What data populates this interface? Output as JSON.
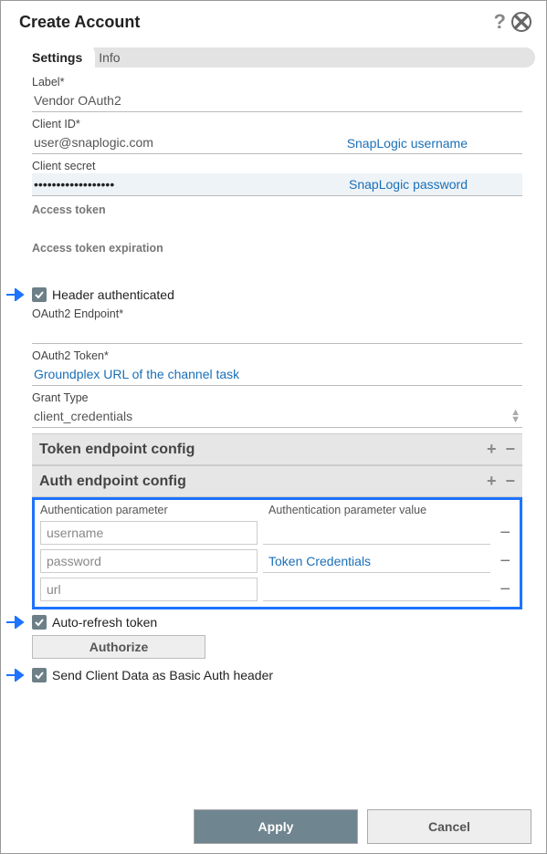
{
  "title": "Create Account",
  "tabs": {
    "active": "Settings",
    "inactive": "Info"
  },
  "fields": {
    "labelLabel": "Label*",
    "labelValue": "Vendor OAuth2",
    "clientIdLabel": "Client ID*",
    "clientIdValue": "user@snaplogic.com",
    "clientIdHint": "SnapLogic username",
    "clientSecretLabel": "Client secret",
    "clientSecretValue": "••••••••••••••••••",
    "clientSecretHint": "SnapLogic password",
    "accessTokenLabel": "Access token",
    "accessTokenExpLabel": "Access token expiration",
    "headerAuthLabel": "Header authenticated",
    "oauthEndpointLabel": "OAuth2 Endpoint*",
    "oauthTokenLabel": "OAuth2 Token*",
    "oauthTokenValue": "Groundplex URL of the channel task",
    "grantTypeLabel": "Grant Type",
    "grantTypeValue": "client_credentials",
    "tokenEndpointHeader": "Token endpoint config",
    "authEndpointHeader": "Auth endpoint config",
    "authParamHeader": "Authentication parameter",
    "authValueHeader": "Authentication parameter value",
    "authRows": [
      {
        "param": "username",
        "value": ""
      },
      {
        "param": "password",
        "value": "Token Credentials"
      },
      {
        "param": "url",
        "value": ""
      }
    ],
    "autoRefreshLabel": "Auto-refresh token",
    "authorizeLabel": "Authorize",
    "sendClientDataLabel": "Send Client Data as Basic Auth header"
  },
  "buttons": {
    "apply": "Apply",
    "cancel": "Cancel"
  }
}
